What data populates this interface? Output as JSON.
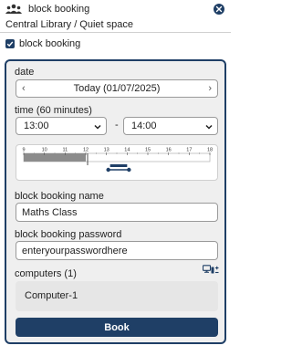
{
  "header": {
    "title": "block booking",
    "location": "Central Library / Quiet space"
  },
  "block_toggle": {
    "label": "block booking",
    "checked": true
  },
  "form": {
    "date_label": "date",
    "date_value": "Today (01/07/2025)",
    "time_label": "time (60 minutes)",
    "start_time": "13:00",
    "end_time": "14:00",
    "time_separator": "-",
    "timeline": {
      "hours": [
        "9",
        "10",
        "11",
        "12",
        "13",
        "14",
        "15",
        "16",
        "17",
        "18"
      ],
      "past_until_hour": 12,
      "selected_start_hour": 13,
      "selected_end_hour": 14
    },
    "name_label": "block booking name",
    "name_value": "Maths Class",
    "password_label": "block booking password",
    "password_value": "enteryourpasswordhere",
    "computers_label": "computers (1)",
    "computers": [
      "Computer-1"
    ],
    "book_label": "Book"
  },
  "colors": {
    "primary": "#1f3f66",
    "panel_bg": "#efefef",
    "past_time": "#8c8c8c"
  },
  "icons": {
    "logo": "people-group-icon",
    "close": "close-icon",
    "computers": "computers-add-icon"
  }
}
